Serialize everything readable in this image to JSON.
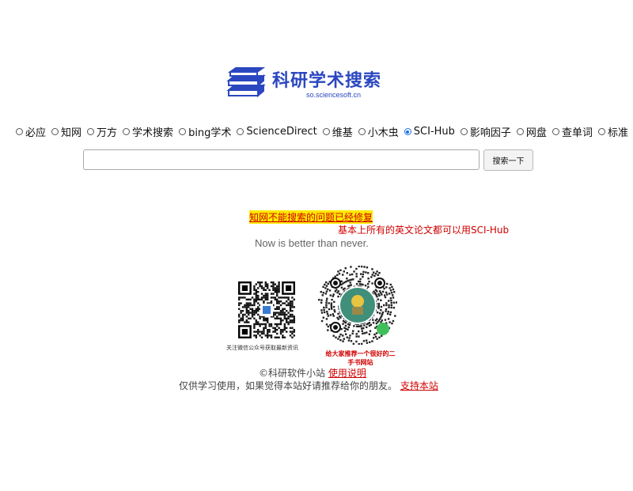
{
  "logo": {
    "title": "科研学术搜索",
    "domain": "so.sciencesoft.cn",
    "brand_color": "#2b47c0"
  },
  "engines": [
    {
      "label": "必应",
      "checked": false
    },
    {
      "label": "知网",
      "checked": false
    },
    {
      "label": "万方",
      "checked": false
    },
    {
      "label": "学术搜索",
      "checked": false
    },
    {
      "label": "bing学术",
      "checked": false
    },
    {
      "label": "ScienceDirect",
      "checked": false
    },
    {
      "label": "维基",
      "checked": false
    },
    {
      "label": "小木虫",
      "checked": false
    },
    {
      "label": "SCI-Hub",
      "checked": true
    },
    {
      "label": "影响因子",
      "checked": false
    },
    {
      "label": "网盘",
      "checked": false
    },
    {
      "label": "查单词",
      "checked": false
    },
    {
      "label": "标准",
      "checked": false
    }
  ],
  "search": {
    "value": "",
    "button_label": "搜索一下"
  },
  "notices": {
    "fixed": "知网不能搜索的问题已经修复",
    "scihub": "基本上所有的英文论文都可以用SCI-Hub",
    "motto": "Now is better than never."
  },
  "qr": {
    "wechat_caption": "关注微信公众号获取最新资讯",
    "recommend_caption": "给大家推荐一个很好的二手书网站"
  },
  "footer": {
    "copyright": "©科研软件小站",
    "usage_link": "使用说明",
    "note": "仅供学习使用，如果觉得本站好请推荐给你的朋友。",
    "support_link": "支持本站"
  }
}
